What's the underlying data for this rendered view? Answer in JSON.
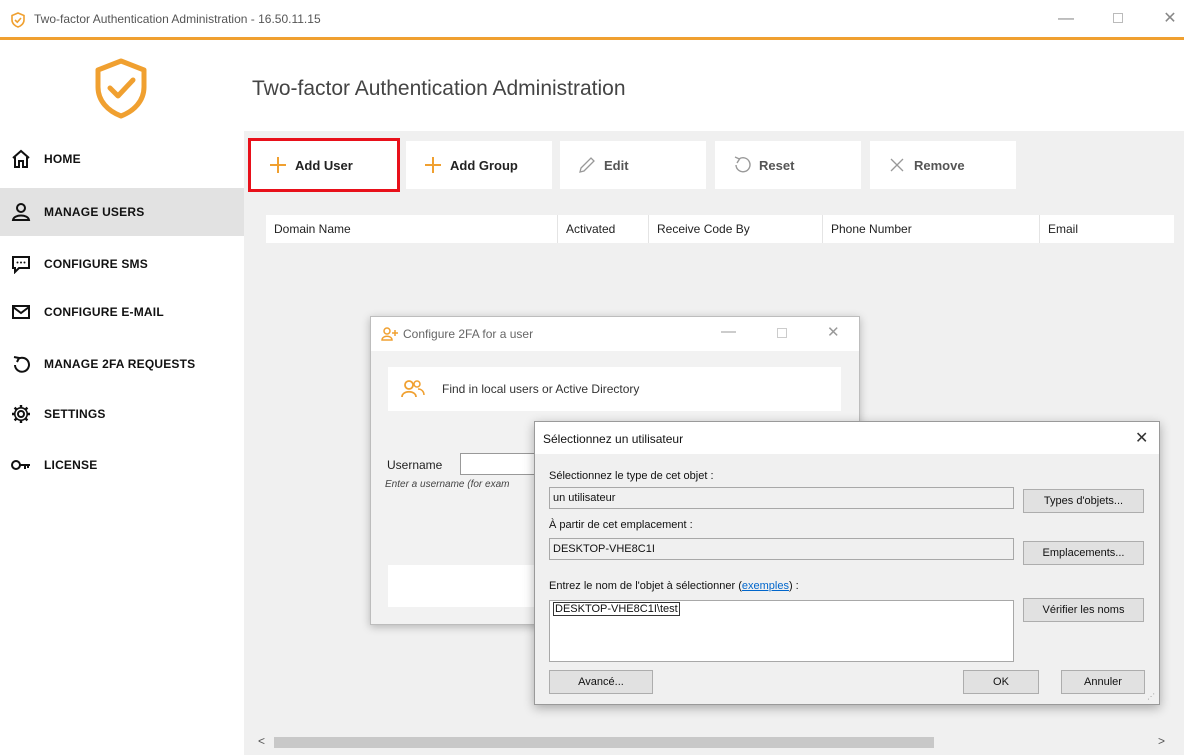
{
  "window": {
    "title": "Two-factor Authentication Administration - 16.50.11.15",
    "min_icon": "minimize-icon",
    "max_icon": "maximize-icon",
    "close_glyph": "✕"
  },
  "colors": {
    "accent": "#f0a030",
    "highlight": "#e8101a"
  },
  "sidebar": {
    "items": [
      {
        "label": "HOME",
        "icon": "home-icon"
      },
      {
        "label": "MANAGE USERS",
        "icon": "user-icon",
        "active": true
      },
      {
        "label": "CONFIGURE SMS",
        "icon": "sms-icon"
      },
      {
        "label": "CONFIGURE E-MAIL",
        "icon": "mail-icon"
      },
      {
        "label": "MANAGE 2FA REQUESTS",
        "icon": "undo-icon"
      },
      {
        "label": "SETTINGS",
        "icon": "gear-icon"
      },
      {
        "label": "LICENSE",
        "icon": "key-icon"
      }
    ]
  },
  "main": {
    "title": "Two-factor Authentication Administration",
    "toolbar": {
      "add_user": "Add User",
      "add_group": "Add Group",
      "edit": "Edit",
      "reset": "Reset",
      "remove": "Remove"
    },
    "columns": [
      "Domain Name",
      "Activated",
      "Receive Code By",
      "Phone Number",
      "Email"
    ],
    "scroll_left": "<",
    "scroll_right": ">"
  },
  "dialog_config": {
    "title": "Configure 2FA for a user",
    "find_label": "Find in local users or Active Directory",
    "username_label": "Username",
    "username_value": "",
    "username_hint": "Enter a username (for exam"
  },
  "dialog_select": {
    "title": "Sélectionnez un utilisateur",
    "type_label": "Sélectionnez le type de cet objet :",
    "type_value": "un utilisateur",
    "types_button": "Types d'objets...",
    "location_label": "À partir de cet emplacement :",
    "location_value": "DESKTOP-VHE8C1I",
    "locations_button": "Emplacements...",
    "name_label_prefix": "Entrez le nom de l'objet à sélectionner (",
    "name_label_link": "exemples",
    "name_label_suffix": ") :",
    "name_value": "DESKTOP-VHE8C1I\\test",
    "check_names_button": "Vérifier les noms",
    "advanced_button": "Avancé...",
    "ok_button": "OK",
    "cancel_button": "Annuler",
    "close_glyph": "✕"
  }
}
